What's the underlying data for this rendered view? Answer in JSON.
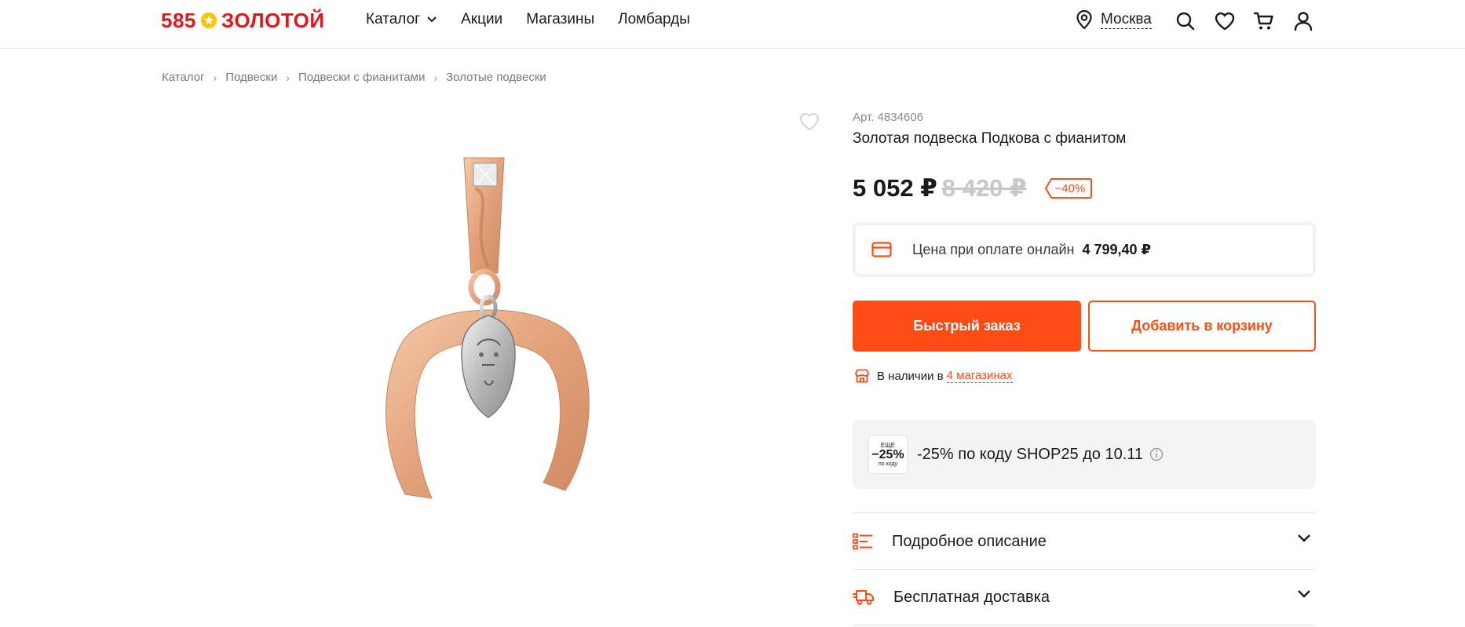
{
  "header": {
    "logo_left": "585",
    "logo_right": "ЗОЛОТОЙ",
    "nav": [
      {
        "label": "Каталог"
      },
      {
        "label": "Акции"
      },
      {
        "label": "Магазины"
      },
      {
        "label": "Ломбарды"
      }
    ],
    "city": "Москва",
    "icons": [
      "location-icon",
      "search-icon",
      "heart-icon",
      "cart-icon",
      "user-icon"
    ]
  },
  "breadcrumb": [
    "Каталог",
    "Подвески",
    "Подвески с фианитами",
    "Золотые подвески"
  ],
  "product": {
    "article": "Арт. 4834606",
    "title": "Золотая подвеска Подкова с фианитом",
    "price": "5 052 ₽",
    "old_price": "8 420 ₽",
    "discount": "−40%",
    "online_label": "Цена при оплате онлайн",
    "online_price": "4 799,40 ₽",
    "quick_order": "Быстрый заказ",
    "add_to_cart": "Добавить в корзину",
    "stock_text": "В наличии в",
    "stock_link": "4 магазинах",
    "promo_badge_top": "ЕЩЕ",
    "promo_badge_value": "−25%",
    "promo_badge_bottom": "по коду",
    "promo_text": "-25% по коду SHOP25 до 10.11",
    "accordion": [
      {
        "label": "Подробное описание"
      },
      {
        "label": "Бесплатная доставка"
      }
    ]
  },
  "colors": {
    "accent": "#ff4b14",
    "logo_red": "#e3171b",
    "logo_star": "#ffc400",
    "gold": "#e6ad8a"
  }
}
